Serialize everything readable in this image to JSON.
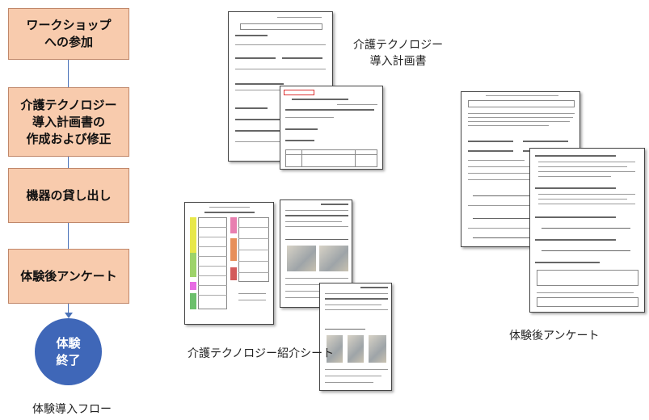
{
  "flow": {
    "steps": [
      {
        "line1": "ワークショップ",
        "line2": "への参加",
        "line3": ""
      },
      {
        "line1": "介護テクノロジー",
        "line2": "導入計画書の",
        "line3": "作成および修正"
      },
      {
        "line1": "機器の貸し出し",
        "line2": "",
        "line3": ""
      },
      {
        "line1": "体験後アンケート",
        "line2": "",
        "line3": ""
      }
    ],
    "end": {
      "line1": "体験",
      "line2": "終了"
    },
    "caption": "体験導入フロー",
    "colors": {
      "box": "#f8cbad",
      "connector": "#4a72b8",
      "end_circle": "#3f67b8"
    }
  },
  "documents": {
    "plan": {
      "line1": "介護テクノロジー",
      "line2": "導入計画書"
    },
    "intro": {
      "label": "介護テクノロジー紹介シート"
    },
    "survey": {
      "label": "体験後アンケート"
    }
  }
}
